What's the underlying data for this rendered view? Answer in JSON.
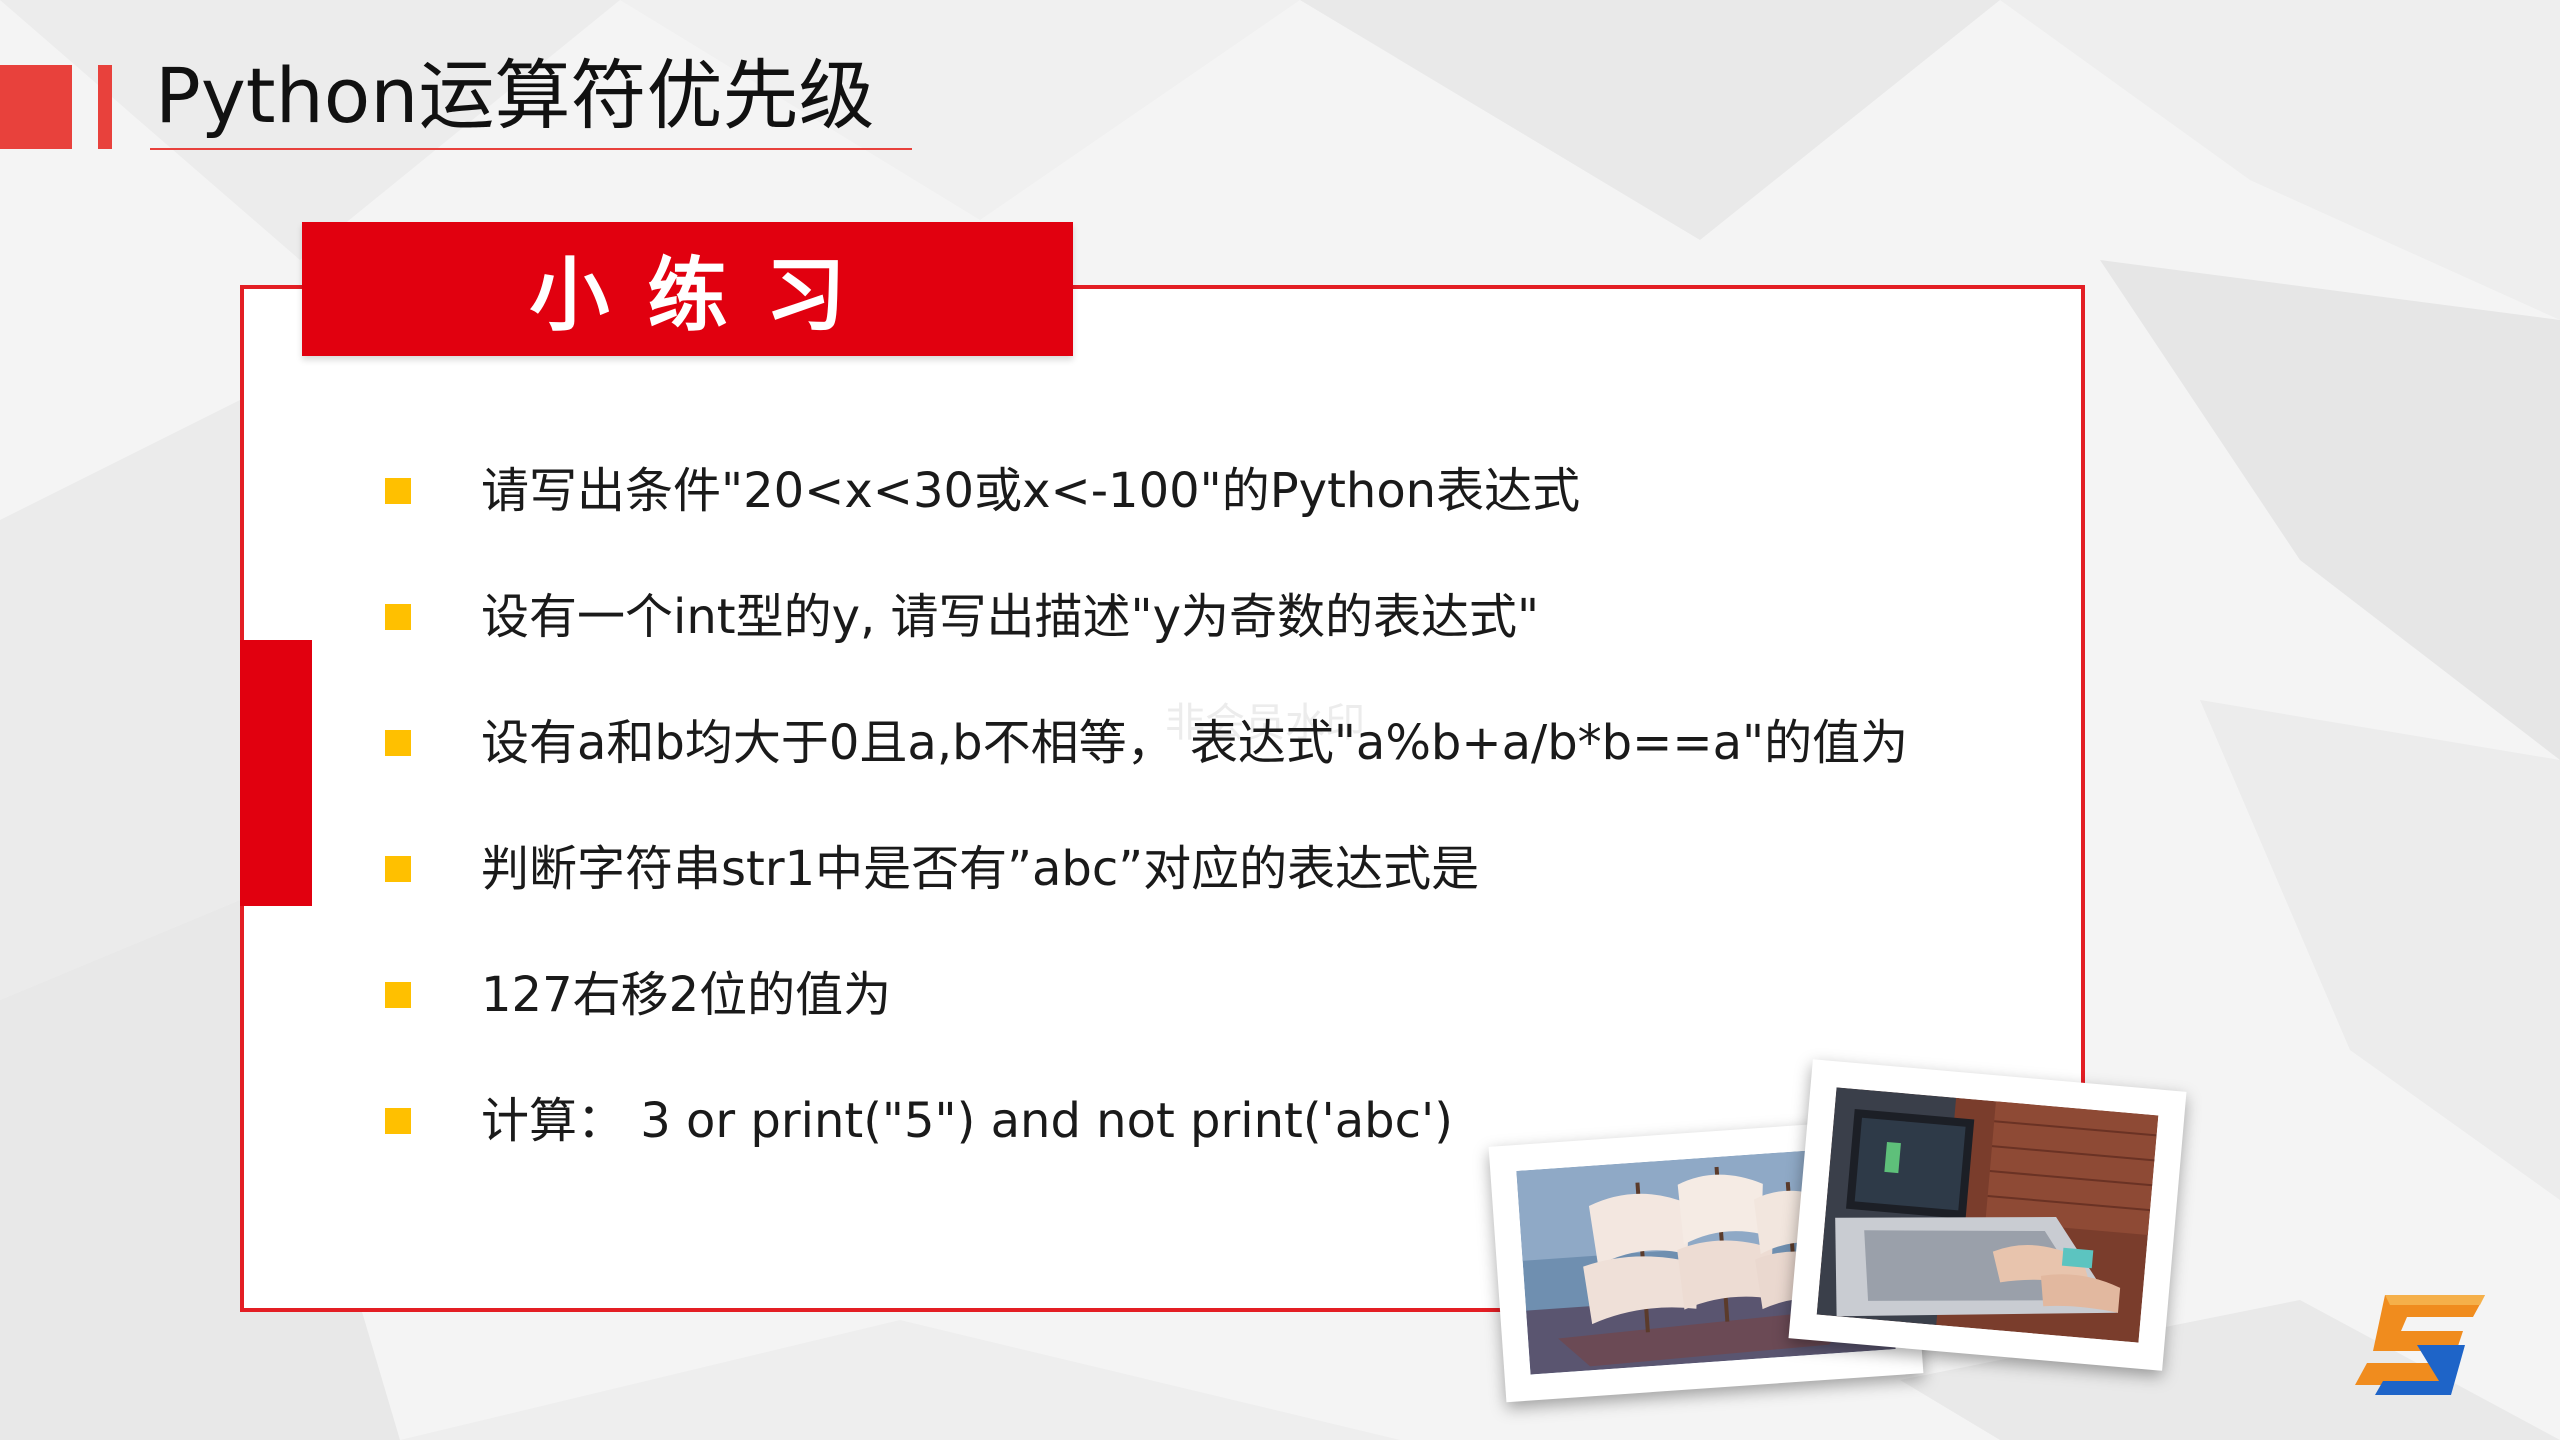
{
  "page": {
    "title": "Python运算符优先级"
  },
  "panel": {
    "banner_label": "小练习"
  },
  "exercises": [
    {
      "text": "请写出条件\"20<x<30或x<-100\"的Python表达式"
    },
    {
      "text": "设有一个int型的y, 请写出描述\"y为奇数的表达式\""
    },
    {
      "text": "设有a和b均大于0且a,b不相等， 表达式\"a%b+a/b*b==a\"的值为"
    },
    {
      "text": "判断字符串str1中是否有”abc”对应的表达式是"
    },
    {
      "text": "127右移2位的值为"
    },
    {
      "text": "计算： 3 or print(\"5\") and not print('abc')"
    }
  ],
  "watermark": "非会员水印",
  "colors": {
    "accent_red": "#e1000f",
    "title_red": "#e8413c",
    "bullet_yellow": "#ffc000",
    "logo_orange": "#f08c1e",
    "logo_blue": "#1e64c8"
  },
  "icons": {
    "bullet": "square-bullet-icon",
    "logo": "brand-s-logo-icon"
  }
}
